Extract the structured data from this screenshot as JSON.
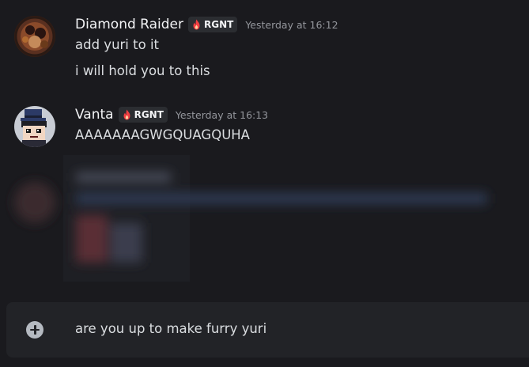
{
  "messages": [
    {
      "username": "Diamond Raider",
      "tag": "RGNT",
      "timestamp": "Yesterday at 16:12",
      "lines": [
        "add yuri to it",
        "i will hold you to this"
      ]
    },
    {
      "username": "Vanta",
      "tag": "RGNT",
      "timestamp": "Yesterday at 16:13",
      "lines": [
        "AAAAAAAGWGQUAGQUHA"
      ]
    }
  ],
  "composer": {
    "text": "are you up to make furry yuri"
  },
  "colors": {
    "background": "#1a1a1e",
    "username": "#f2f3f5",
    "timestamp": "#94969c",
    "message_text": "#dbdee1",
    "tag_bg": "#2b2d31",
    "tag_icon": "#f23f43",
    "composer_bg": "#222327"
  },
  "icons": {
    "tag_icon": "flame-icon",
    "composer_add": "plus-circle-icon"
  }
}
